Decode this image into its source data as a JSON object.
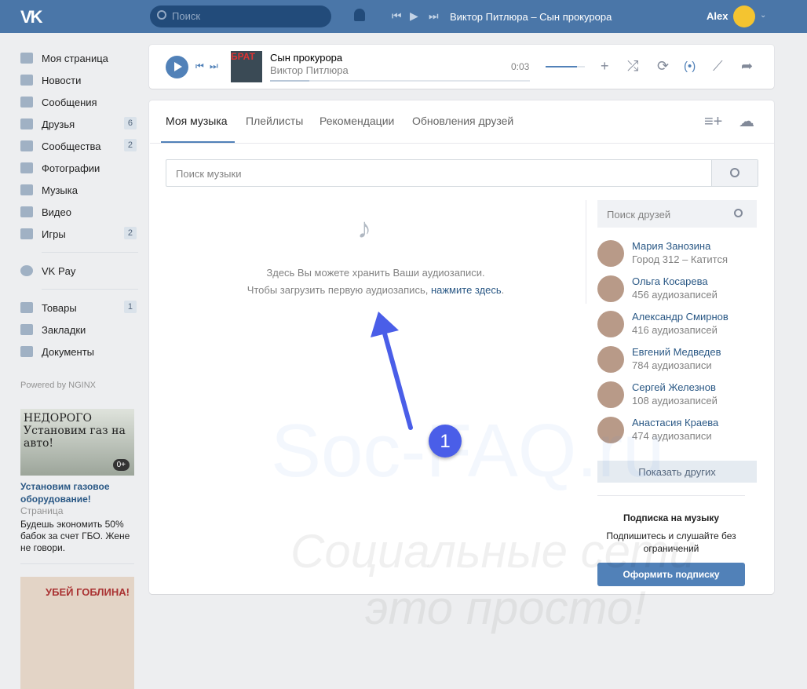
{
  "header": {
    "logo": "VK",
    "search_placeholder": "Поиск",
    "now_playing": "Виктор Питлюра – Сын прокурора",
    "user": "Alex"
  },
  "sidebar": {
    "items": [
      {
        "label": "Моя страница"
      },
      {
        "label": "Новости"
      },
      {
        "label": "Сообщения"
      },
      {
        "label": "Друзья",
        "count": "6"
      },
      {
        "label": "Сообщества",
        "count": "2"
      },
      {
        "label": "Фотографии"
      },
      {
        "label": "Музыка"
      },
      {
        "label": "Видео"
      },
      {
        "label": "Игры",
        "count": "2"
      }
    ],
    "vkpay": "VK Pay",
    "extra": [
      {
        "label": "Товары",
        "count": "1"
      },
      {
        "label": "Закладки"
      },
      {
        "label": "Документы"
      }
    ],
    "powered": "Powered by NGINX"
  },
  "ads": [
    {
      "image_text": "НЕДОРОГО Установим газ на авто!",
      "age": "0+",
      "title": "Установим газовое оборудование!",
      "type": "Страница",
      "desc": "Будешь экономить 50% бабок за счет ГБО. Жене не говори."
    },
    {
      "image_text": "УБЕЙ ГОБЛИНА!"
    }
  ],
  "player": {
    "cover_text": "БРАТ",
    "title": "Сын прокурора",
    "artist": "Виктор Питлюра",
    "time": "0:03",
    "progress": 0.15,
    "volume": 0.8
  },
  "tabs": [
    "Моя музыка",
    "Плейлисты",
    "Рекомендации",
    "Обновления друзей"
  ],
  "music_search_placeholder": "Поиск музыки",
  "empty": {
    "line1": "Здесь Вы можете хранить Ваши аудиозаписи.",
    "line2": "Чтобы загрузить первую аудиозапись,",
    "link": "нажмите здесь",
    "end": "."
  },
  "friends_search_placeholder": "Поиск друзей",
  "friends": [
    {
      "name": "Мария Занозина",
      "sub": "Город 312 – Катится"
    },
    {
      "name": "Ольга Косарева",
      "sub": "456 аудиозаписей"
    },
    {
      "name": "Александр Смирнов",
      "sub": "416 аудиозаписей"
    },
    {
      "name": "Евгений Медведев",
      "sub": "784 аудиозаписи"
    },
    {
      "name": "Сергей Железнов",
      "sub": "108 аудиозаписей"
    },
    {
      "name": "Анастасия Краева",
      "sub": "474 аудиозаписи"
    }
  ],
  "show_more": "Показать других",
  "subscription": {
    "title": "Подписка на музыку",
    "text": "Подпишитесь и слушайте без ограничений",
    "button": "Оформить подписку"
  },
  "annotation": {
    "number": "1",
    "color": "#4a5ee8"
  },
  "watermark": {
    "line1": "Soc-FAQ.ru",
    "line2": "Социальные сети",
    "line3": "это просто!"
  }
}
